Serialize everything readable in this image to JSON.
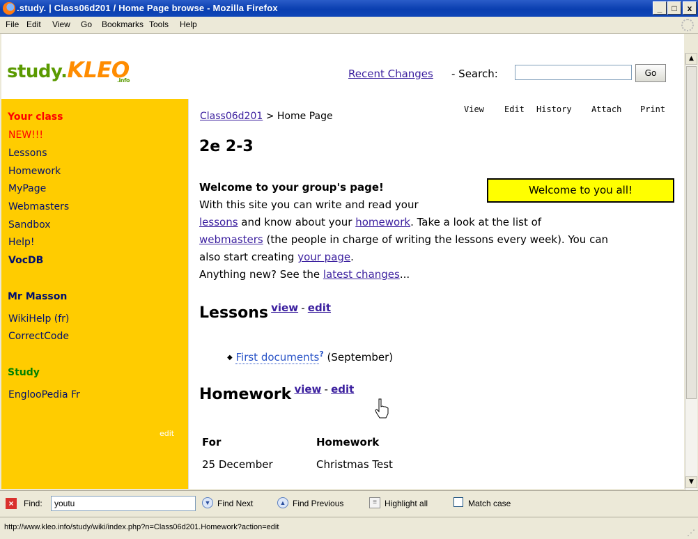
{
  "window": {
    "title": ".study. | Class06d201 / Home Page browse - Mozilla Firefox",
    "minimize": "_",
    "maximize": "□",
    "close": "x"
  },
  "menu": [
    "File",
    "Edit",
    "View",
    "Go",
    "Bookmarks",
    "Tools",
    "Help"
  ],
  "logo": {
    "part1": "study.",
    "part2": "KLEO",
    "part3": ".info"
  },
  "header": {
    "recent_changes": "Recent Changes",
    "search_sep": " - Search:",
    "search_value": "",
    "go_label": "Go"
  },
  "sidebar": {
    "your_class_heading": "Your class",
    "class_items": [
      "NEW!!!",
      "Lessons",
      "Homework",
      "MyPage",
      "Webmasters",
      "Sandbox",
      "Help!",
      "VocDB"
    ],
    "teacher_heading": "Mr Masson",
    "teacher_items": [
      "WikiHelp (fr)",
      "CorrectCode"
    ],
    "study_heading": "Study",
    "study_items": [
      "EnglooPedia Fr"
    ],
    "edit_label": "edit"
  },
  "page_actions": [
    "View",
    "Edit",
    "History",
    "Attach",
    "Print"
  ],
  "breadcrumb": {
    "group": "Class06d201",
    "sep": " > ",
    "page": "Home Page"
  },
  "content": {
    "title": "2e 2-3",
    "welcome_heading": "Welcome to your group's page!",
    "welcome_box": "Welcome to you all!",
    "line1": "With this site you can write and read your",
    "lessons_link": "lessons",
    "line2a": " and know about your ",
    "homework_link": "homework",
    "line2b": ". Take a look at the list of",
    "webmasters_link": "webmasters",
    "line3": " (the people in charge of writing the lessons every week). You can",
    "line4a": "also start creating ",
    "yourpage_link": "your page",
    "line4b": ".",
    "line5a": "Anything new? See the ",
    "latest_link": "latest changes",
    "line5b": "...",
    "lessons_heading": "Lessons",
    "view": "view",
    "dash": "-",
    "edit": "edit",
    "lesson_item_link": "First documents",
    "lesson_item_q": "?",
    "lesson_item_note": "(September)",
    "homework_heading": "Homework",
    "table_head": [
      "For",
      "Homework"
    ],
    "table_row": [
      "25 December",
      "Christmas Test"
    ]
  },
  "findbar": {
    "find_label": "Find:",
    "find_value": "youtu",
    "find_next": "Find Next",
    "find_previous": "Find Previous",
    "highlight_all": "Highlight all",
    "match_case": "Match case"
  },
  "status_url": "http://www.kleo.info/study/wiki/index.php?n=Class06d201.Homework?action=edit"
}
